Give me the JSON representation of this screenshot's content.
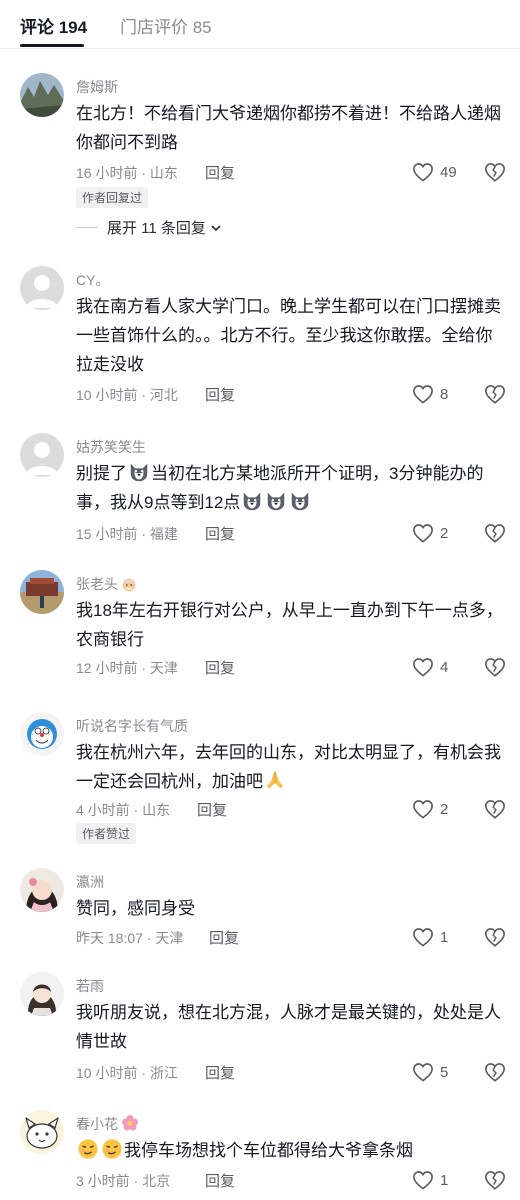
{
  "tabs": [
    {
      "label": "评论 194",
      "active": true
    },
    {
      "label": "门店评价 85",
      "active": false
    }
  ],
  "comments": [
    {
      "nickname": "詹姆斯",
      "text": "在北方！不给看门大爷递烟你都捞不着进！不给路人递烟你都问不到路",
      "meta": "16 小时前 · 山东",
      "reply_label": "回复",
      "likes": "49",
      "badge": "作者回复过",
      "expand_label": "展开 11 条回复"
    },
    {
      "nickname": "CY。",
      "text": "我在南方看人家大学门口。晚上学生都可以在门口摆摊卖一些首饰什么的。。北方不行。至少我这你敢摆。全给你拉走没收",
      "meta": "10 小时前 · 河北",
      "reply_label": "回复",
      "likes": "8"
    },
    {
      "nickname": "姑苏笑笑生",
      "text_parts": [
        "别提了",
        "当初在北方某地派所开个证明，3分钟能办的事，我从9点等到12点"
      ],
      "meta": "15 小时前 · 福建",
      "reply_label": "回复",
      "likes": "2"
    },
    {
      "nickname": "张老头",
      "text": "我18年左右开银行对公户，从早上一直办到下午一点多，农商银行",
      "meta": "12 小时前 · 天津",
      "reply_label": "回复",
      "likes": "4"
    },
    {
      "nickname": "听说名字长有气质",
      "text": "我在杭州六年，去年回的山东，对比太明显了，有机会我一定还会回杭州，加油吧",
      "meta": "4 小时前 · 山东",
      "reply_label": "回复",
      "likes": "2",
      "badge": "作者赞过"
    },
    {
      "nickname": "瀛洲",
      "text": "赞同，感同身受",
      "meta": "昨天 18:07 · 天津",
      "reply_label": "回复",
      "likes": "1"
    },
    {
      "nickname": "若雨",
      "text": "我听朋友说，想在北方混，人脉才是最关键的，处处是人情世故",
      "meta": "10 小时前 · 浙江",
      "reply_label": "回复",
      "likes": "5"
    },
    {
      "nickname": "春小花",
      "text": "我停车场想找个车位都得给大爷拿条烟",
      "meta": "3 小时前 · 北京",
      "reply_label": "回复",
      "likes": "1"
    }
  ],
  "icons": {
    "like": "heart-outline-icon",
    "dislike": "broken-heart-icon",
    "expand": "chevron-down-icon",
    "husky_emoji": "husky-face-emoji",
    "pray_emoji": "folded-hands-emoji",
    "smug_emoji": "smirk-face-emoji"
  }
}
